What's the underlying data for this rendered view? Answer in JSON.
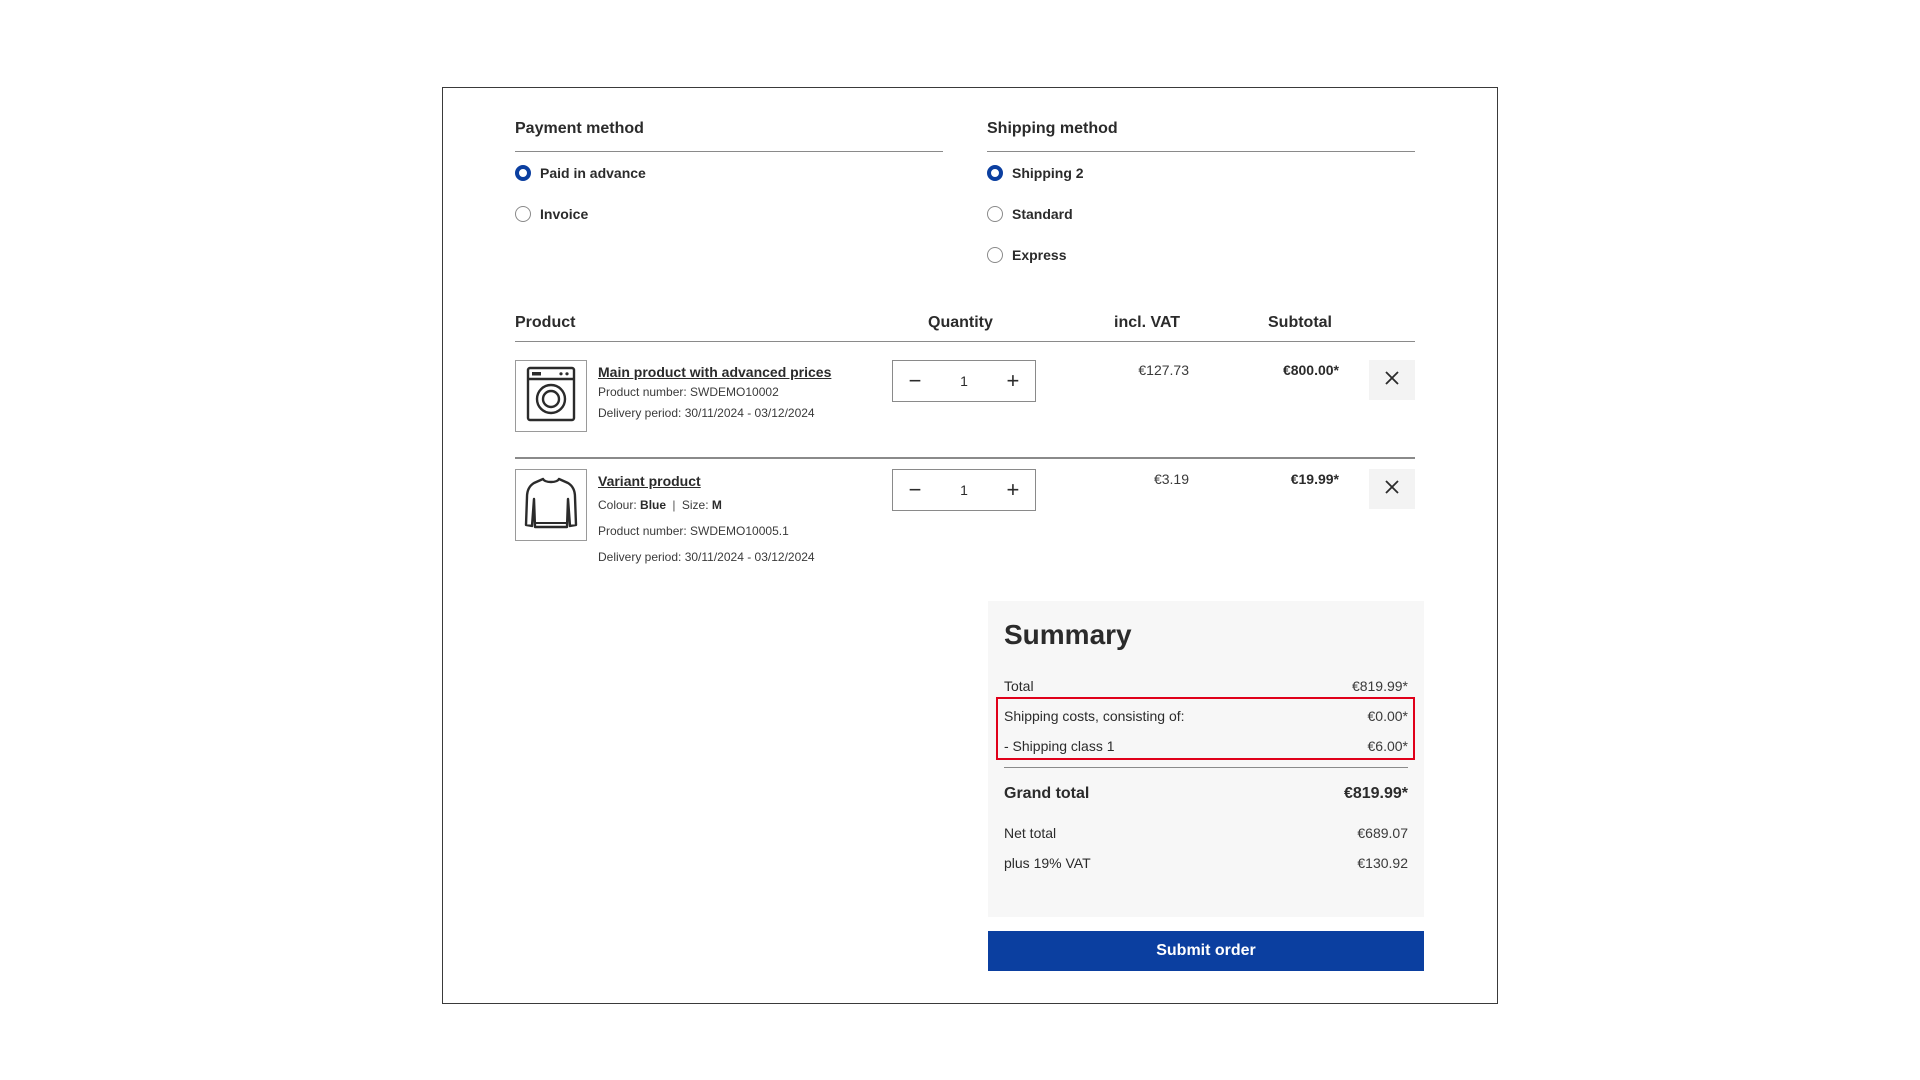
{
  "payment": {
    "title": "Payment method",
    "options": [
      {
        "label": "Paid in advance",
        "checked": true
      },
      {
        "label": "Invoice",
        "checked": false
      }
    ]
  },
  "shipping": {
    "title": "Shipping method",
    "options": [
      {
        "label": "Shipping 2",
        "checked": true
      },
      {
        "label": "Standard",
        "checked": false
      },
      {
        "label": "Express",
        "checked": false
      }
    ]
  },
  "cart": {
    "headers": {
      "product": "Product",
      "quantity": "Quantity",
      "vat": "incl. VAT",
      "subtotal": "Subtotal"
    },
    "items": [
      {
        "name": "Main product with advanced prices",
        "product_number": "Product number: SWDEMO10002",
        "delivery": "Delivery period: 30/11/2024 - 03/12/2024",
        "quantity": "1",
        "vat": "€127.73",
        "subtotal": "€800.00*",
        "icon": "washing-machine-icon"
      },
      {
        "name": "Variant product",
        "colour_label": "Colour:",
        "colour_value": "Blue",
        "size_label": "Size:",
        "size_value": "M",
        "product_number": "Product number: SWDEMO10005.1",
        "delivery": "Delivery period: 30/11/2024 - 03/12/2024",
        "quantity": "1",
        "vat": "€3.19",
        "subtotal": "€19.99*",
        "icon": "sweater-icon"
      }
    ],
    "minus": "−",
    "plus": "+",
    "separator": "|"
  },
  "summary": {
    "title": "Summary",
    "total_label": "Total",
    "total_value": "€819.99*",
    "shipping_label": "Shipping costs, consisting of:",
    "shipping_value": "€0.00*",
    "shipping_class_label": "- Shipping class 1",
    "shipping_class_value": "€6.00*",
    "grand_label": "Grand total",
    "grand_value": "€819.99*",
    "net_label": "Net total",
    "net_value": "€689.07",
    "vat_label": "plus 19% VAT",
    "vat_value": "€130.92"
  },
  "submit_label": "Submit order",
  "colors": {
    "accent": "#0b3fa0",
    "highlight": "#e0001a"
  }
}
